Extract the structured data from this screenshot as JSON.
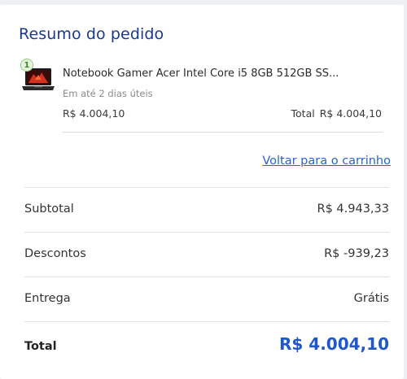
{
  "summary": {
    "title": "Resumo do pedido"
  },
  "item": {
    "quantity": "1",
    "name": "Notebook Gamer Acer Intel Core i5 8GB 512GB SS...",
    "delivery": "Em até 2 dias úteis",
    "price": "R$ 4.004,10",
    "total_label": "Total",
    "total_value": "R$ 4.004,10",
    "thumbnail_icon": "laptop-icon"
  },
  "back_link": "Voltar para o carrinho",
  "totals": [
    {
      "label": "Subtotal",
      "value": "R$ 4.943,33"
    },
    {
      "label": "Descontos",
      "value": "R$ -939,23"
    },
    {
      "label": "Entrega",
      "value": "Grátis"
    }
  ],
  "grand_total": {
    "label": "Total",
    "value": "R$ 4.004,10"
  },
  "colors": {
    "title": "#1b3a8c",
    "link": "#2a63c9",
    "total_value": "#1f56c9",
    "qty_badge": "#8ccf7a"
  }
}
